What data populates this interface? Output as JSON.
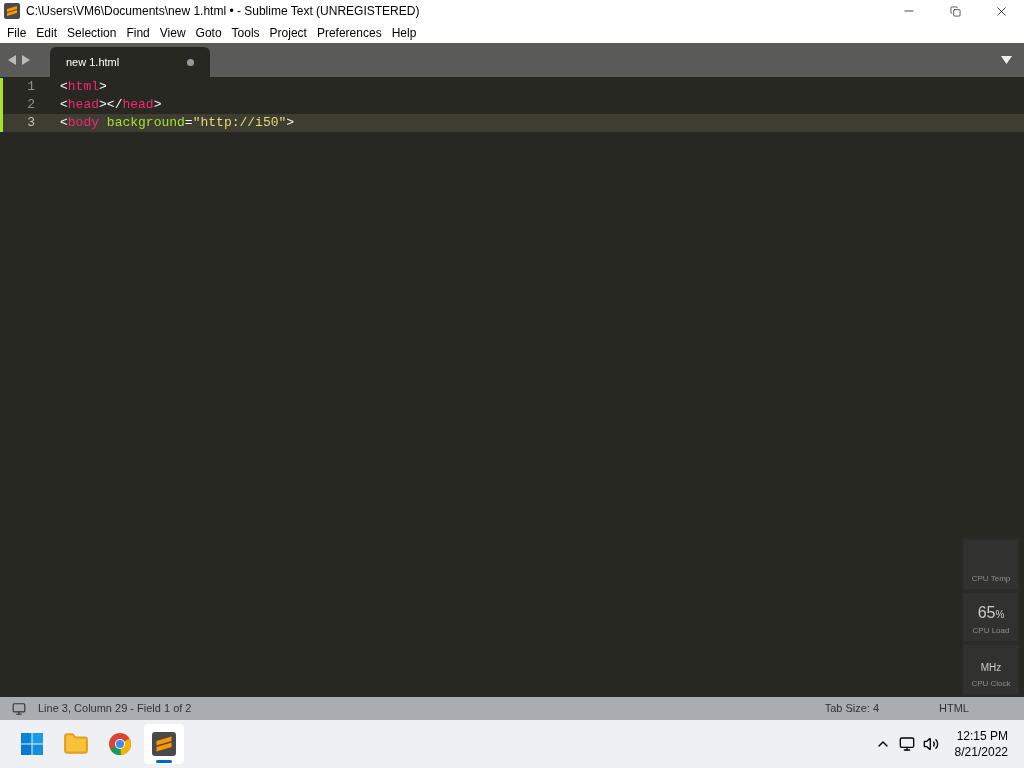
{
  "window": {
    "title": "C:\\Users\\VM6\\Documents\\new 1.html • - Sublime Text (UNREGISTERED)"
  },
  "menu": [
    "File",
    "Edit",
    "Selection",
    "Find",
    "View",
    "Goto",
    "Tools",
    "Project",
    "Preferences",
    "Help"
  ],
  "tabs": [
    {
      "label": "new 1.html",
      "selected": true,
      "modified": true
    }
  ],
  "editor": {
    "lines": [
      {
        "number": "1",
        "current": false,
        "modified": true,
        "tokens": [
          {
            "kind": "punct",
            "text": "<"
          },
          {
            "kind": "tag",
            "text": "html"
          },
          {
            "kind": "punct",
            "text": ">"
          }
        ]
      },
      {
        "number": "2",
        "current": false,
        "modified": true,
        "tokens": [
          {
            "kind": "punct",
            "text": "<"
          },
          {
            "kind": "tag",
            "text": "head"
          },
          {
            "kind": "punct",
            "text": "></"
          },
          {
            "kind": "tag",
            "text": "head"
          },
          {
            "kind": "punct",
            "text": ">"
          }
        ]
      },
      {
        "number": "3",
        "current": true,
        "modified": true,
        "tokens": [
          {
            "kind": "punct",
            "text": "<"
          },
          {
            "kind": "tag",
            "text": "body"
          },
          {
            "kind": "attr",
            "text": " background"
          },
          {
            "kind": "punct",
            "text": "="
          },
          {
            "kind": "string",
            "text": "\"http://i50\""
          },
          {
            "kind": "punct",
            "text": ">"
          }
        ]
      }
    ]
  },
  "status_bar": {
    "position": "Line 3, Column 29 - Field 1 of 2",
    "tab_size": "Tab Size: 4",
    "syntax": "HTML"
  },
  "gadget": [
    {
      "label": "CPU Temp"
    },
    {
      "value": "65",
      "unit": "%",
      "label": "CPU Load"
    },
    {
      "unit": "MHz",
      "label": "CPU Clock"
    }
  ],
  "taskbar": {
    "apps": [
      {
        "kind": "start",
        "selected": false
      },
      {
        "kind": "folder",
        "selected": false
      },
      {
        "kind": "browser",
        "selected": false
      },
      {
        "kind": "sublime",
        "selected": true
      }
    ],
    "time": "12:15 PM",
    "date": "8/21/2022"
  }
}
